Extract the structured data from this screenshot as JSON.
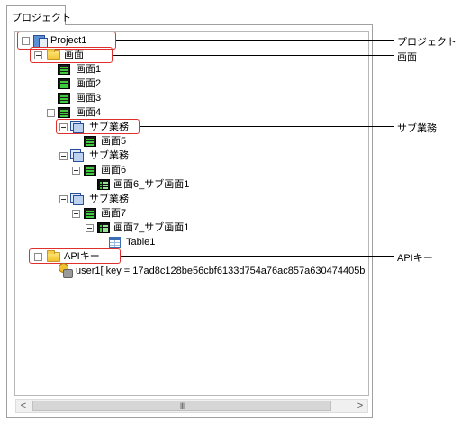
{
  "tab": {
    "label": "プロジェクト"
  },
  "tree": {
    "project": "Project1",
    "screens_folder": "画面",
    "screens": [
      "画面1",
      "画面2",
      "画面3",
      "画面4"
    ],
    "subtask_a": "サブ業務",
    "screen5": "画面5",
    "subtask_b": "サブ業務",
    "screen6": "画面6",
    "screen6_sub": "画面6_サブ画面1",
    "subtask_c": "サブ業務",
    "screen7": "画面7",
    "screen7_sub": "画面7_サブ画面1",
    "table1": "Table1",
    "api_folder": "APIキー",
    "api_entry": "user1[ key = 17ad8c128be56cbf6133d754a76ac857a630474405b"
  },
  "annotations": {
    "project": "プロジェクト",
    "screens": "画面",
    "subtask": "サブ業務",
    "apikey": "APIキー"
  },
  "scrollbar": {
    "left": "<",
    "right": ">",
    "grip": "III"
  },
  "colors": {
    "highlight": "#e0302c",
    "border": "#a0a0a0",
    "screen_icon_green": "#3ecb3e"
  }
}
